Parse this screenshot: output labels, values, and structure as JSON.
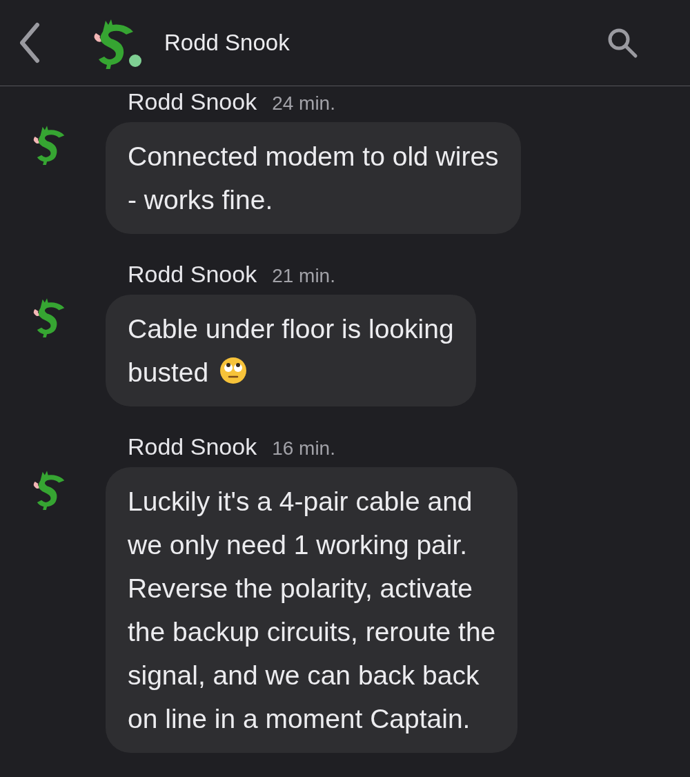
{
  "header": {
    "contact_name": "Rodd Snook",
    "online": true
  },
  "messages": [
    {
      "sender": "Rodd Snook",
      "time": "24 min.",
      "text": "Connected modem to old wires\n- works fine."
    },
    {
      "sender": "Rodd Snook",
      "time": "21 min.",
      "text": "Cable under floor is looking\nbusted",
      "emoji_after": true
    },
    {
      "sender": "Rodd Snook",
      "time": "16 min.",
      "text": "Luckily it's a 4-pair cable and\nwe only need 1 working pair.\nReverse the polarity, activate\nthe backup circuits, reroute the\nsignal, and we can back back\non line in a moment Captain."
    }
  ]
}
